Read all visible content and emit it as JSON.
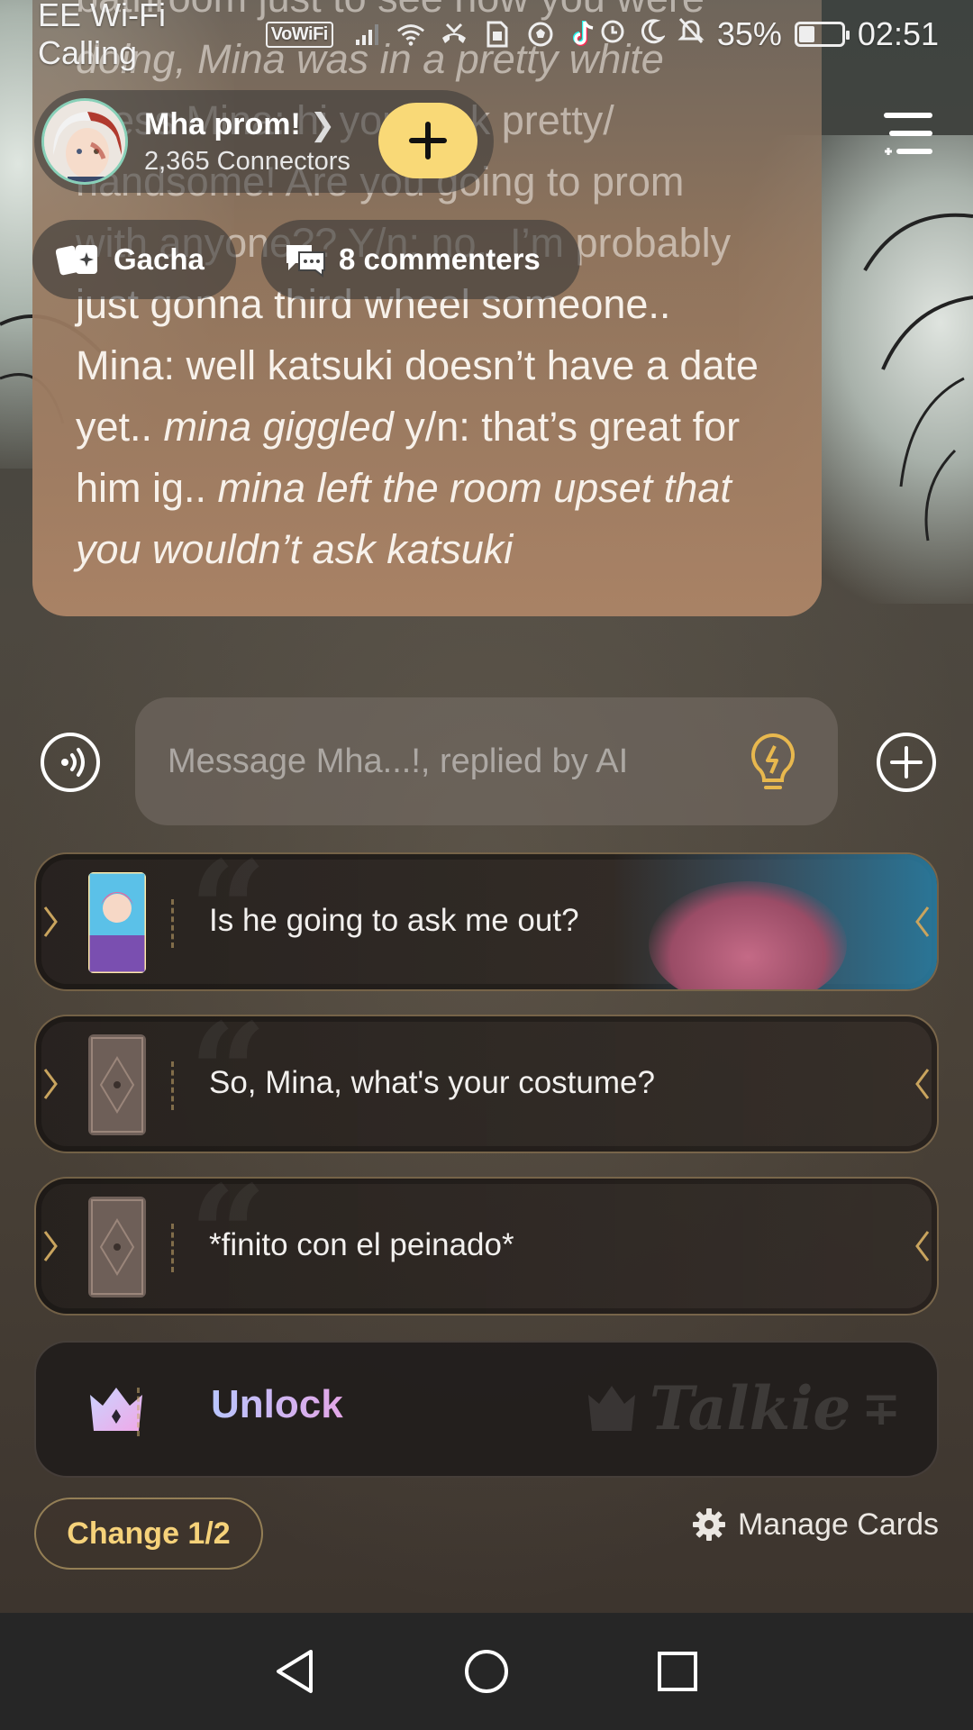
{
  "status_bar": {
    "carrier": "EE Wi-Fi Calling",
    "vowifi": "VoWiFi",
    "battery_percent": "35%",
    "battery_level": 0.35,
    "time": "02:51"
  },
  "topic": {
    "title": "Mha prom!",
    "connectors": "2,365 Connectors"
  },
  "chips": {
    "gacha": "Gacha",
    "commenters": "8 commenters"
  },
  "story": {
    "line_top_a": "bathroom just to see how you were",
    "line_top_b": "doing, Mina was in a pretty white",
    "line_top_c": "dress Mina: hi you look pretty/",
    "line_top_d": "handsome! Are you going to prom",
    "line_top_e": "with anyone?? Y/n: no.. I’m probably",
    "part1": "just gonna third wheel someone.. Mina: well katsuki doesn’t have a date yet.. ",
    "italic1": "mina giggled",
    "part2": " y/n: that’s great for him ig.. ",
    "italic2": "mina left the room upset that you wouldn’t ask katsuki"
  },
  "composer": {
    "placeholder": "Message Mha...!, replied by AI"
  },
  "suggestions": [
    {
      "label": "Is he going to ask me out?"
    },
    {
      "label": "So, Mina, what's your costume?"
    },
    {
      "label": "*finito con el peinado*"
    }
  ],
  "unlock": {
    "label": "Unlock",
    "watermark": "Talkie"
  },
  "footer": {
    "change_label": "Change 1/2",
    "manage_label": "Manage Cards"
  },
  "colors": {
    "accent_yellow": "#f9d977",
    "change_text": "#f6d27a",
    "bubble": "#a98265",
    "nav_bar": "#262626"
  }
}
